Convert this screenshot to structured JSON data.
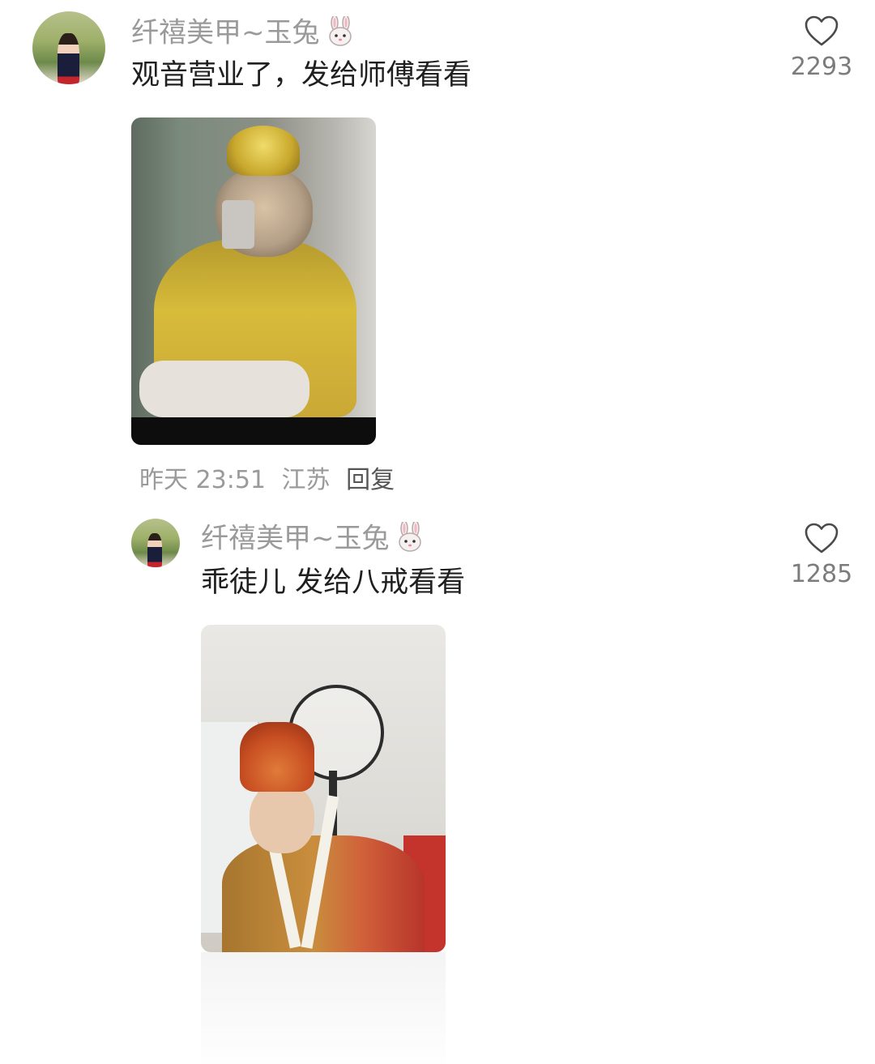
{
  "comments": [
    {
      "username": "纤禧美甲~玉兔",
      "username_emoji": "rabbit-face",
      "text": "观音营业了，发给师傅看看",
      "likes": "2293",
      "meta": {
        "time": "昨天 23:51",
        "location": "江苏",
        "reply_label": "回复"
      }
    },
    {
      "username": "纤禧美甲~玉兔",
      "username_emoji": "rabbit-face",
      "text": "乖徒儿 发给八戒看看",
      "likes": "1285"
    }
  ],
  "colors": {
    "username": "#9a9a9a",
    "text": "#1f1f1f",
    "meta": "#9a9a9a",
    "like_icon": "#4a4a4a"
  }
}
